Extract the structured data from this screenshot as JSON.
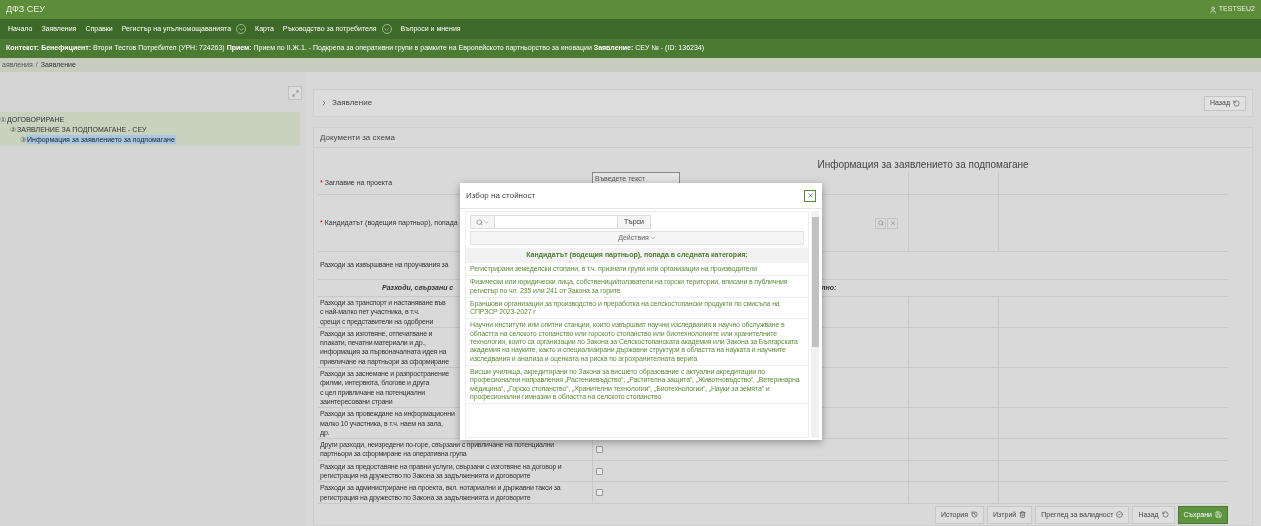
{
  "header": {
    "title": "ДФЗ СЕУ",
    "user": "TESTSEU2"
  },
  "nav": [
    {
      "label": "Начало",
      "kind": "link"
    },
    {
      "label": "Заявления",
      "kind": "link"
    },
    {
      "label": "Справки",
      "kind": "link"
    },
    {
      "label": "Регистър на упълномощаванията",
      "kind": "menu"
    },
    {
      "label": "Карта",
      "kind": "link"
    },
    {
      "label": "Ръководство за потребителя",
      "kind": "menu"
    },
    {
      "label": "Въпроси и мнения",
      "kind": "link"
    }
  ],
  "context": "**Контекст:** **Бенефициент:** Втори Тестов Потребител (УРН: 724263) **Прием:** Прием по II.Ж.1. - Подкрепа за оперативни групи в рамките на Европейското партньорство за иновации **Заявление:** СЕУ № - (ID: 136234)",
  "breadcrumb": [
    "аявления",
    "Заявление"
  ],
  "breadcrumb_separator": "/",
  "tree": [
    {
      "marker": "①",
      "label": "ДОГОВОРИРАНЕ",
      "selected": false,
      "children": [
        {
          "marker": "②",
          "label": "ЗАЯВЛЕНИЕ ЗА ПОДПОМАГАНЕ - СЕУ",
          "selected": false,
          "children": [
            {
              "marker": "③",
              "label": "Информация за заявлението за подпомагане",
              "selected": true
            }
          ]
        }
      ]
    }
  ],
  "panel": {
    "title": "Заявление",
    "back": "Назад",
    "section": "Документи за схема"
  },
  "form": {
    "title": "Информация за заявлението за подпомагане",
    "title_field": {
      "label": "Заглавие на проекта",
      "required": true,
      "marker": "*",
      "placeholder": "Въведете текст"
    },
    "candidate_field": {
      "label": "Кандидатът (водещия партньор), попада",
      "required": true,
      "marker": "*"
    },
    "research_label": "Разходи за извършване на проучвания за",
    "group_heading": "Разходи, свързани с",
    "group_heading_tail": "лно:",
    "rows": [
      {
        "lines": [
          "Разходи за транспорт и настаняване във",
          "с най-малко пет участника, в т.ч.",
          "срещи с представители на одобрени"
        ]
      },
      {
        "lines": [
          "Разходи за изготвяне, отпечатване и",
          "плакати, печатни материали и др.,",
          "информация за първоначалната идея на",
          "привличане на партньори за сформиране"
        ]
      },
      {
        "lines": [
          "Разходи за заснемане и разпространение",
          "филми, интервюта, блогове и друга",
          "с цел привличане на потенциални",
          "заинтересовани страни"
        ]
      },
      {
        "lines": [
          "Разходи за провеждане на информационни",
          "малко 10 участника, в т.ч. наем на зала,",
          "др."
        ]
      },
      {
        "lines": [
          "Други разходи, неизредени по-горе, свързани с привличане на потенциални",
          "партньори за сформиране на оперативна група"
        ],
        "checked": false
      },
      {
        "lines": [
          "Разходи за предоставяне на правни услуги, свързани с изготвяне на договор и",
          "регистрация на дружество по Закона за задълженията и договорите"
        ],
        "checked": false
      },
      {
        "lines": [
          "Разходи за администриране на проекта, вкл. нотариални и държавни такси за",
          "регистрация на дружество по Закона за задълженията и договорите"
        ],
        "checked": false
      }
    ]
  },
  "actions": [
    {
      "label": "История",
      "kind": "history"
    },
    {
      "label": "Изтрий",
      "kind": "delete"
    },
    {
      "label": "Преглед за валидност",
      "kind": "validate"
    },
    {
      "label": "Назад",
      "kind": "back"
    },
    {
      "label": "Съхрани",
      "kind": "save"
    }
  ],
  "modal": {
    "title": "Избор на стойност",
    "search_button": "Търси",
    "actions": "Действия",
    "heading": "Кандидатът (водещия партньор), попада в следната категория:",
    "items": [
      "Регистрирани земеделски стопани, в т.ч. признати групи или организации на производители",
      "Физически или юридически лица, собственици/ползватели на горски територии, вписани в публичния регистър по чл. 235 или 241 от Закона за горите",
      "Браншови организации за производство и преработка на селскостопански продукти по смисъла на СПРЗСР 2023-2027 г",
      "Научни институти или опитни станции, които извършват научни изследвания и научно обслужване в областта на селското стопанство или горското стопанство или биотехнологиите или хранителните технологии, които са организации по Закона за Селскостопанската академия или Закона за Българската академия на науките, както и специализирани държавни структури в областта на науката и научните изследвания и анализа и оценката на риска по агрохранителната верига",
      "Висши училища, акредитирани по Закона за висшето образование с актуални акредитации по професионални направления „Растениевъдство“, „Растителна защита“, „Животновъдство“, „Ветеринарна медицина“, „Горско стопанство“, „Хранителни технологии“, „Биотехнологии“, „Науки за земята“ и професионални гимназии в областта на селското стопанство"
    ]
  }
}
